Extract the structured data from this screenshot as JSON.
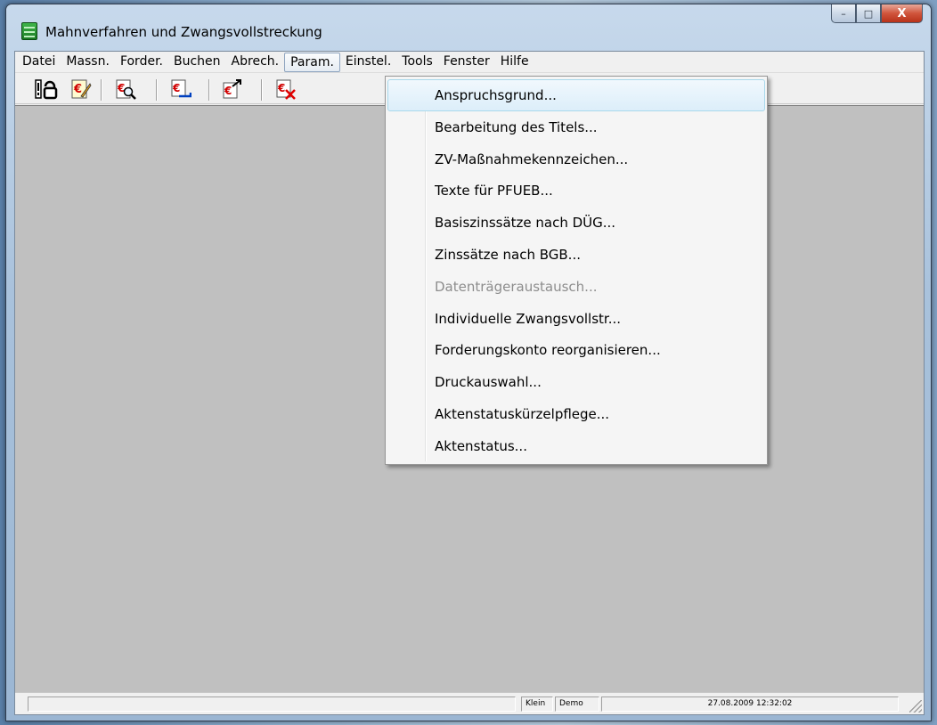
{
  "window": {
    "title": "Mahnverfahren und Zwangsvollstreckung",
    "controls": {
      "minimize": "–",
      "maximize": "□",
      "close": "X"
    }
  },
  "menu_bar": {
    "items": [
      {
        "label": "Datei"
      },
      {
        "label": "Massn."
      },
      {
        "label": "Forder."
      },
      {
        "label": "Buchen"
      },
      {
        "label": "Abrech."
      },
      {
        "label": "Param.",
        "active": true
      },
      {
        "label": "Einstel."
      },
      {
        "label": "Tools"
      },
      {
        "label": "Fenster"
      },
      {
        "label": "Hilfe"
      }
    ]
  },
  "toolbar": {
    "icons": [
      "info-lock-icon",
      "euro-edit-icon",
      "euro-search-icon",
      "euro-list-icon",
      "euro-export-icon",
      "euro-delete-icon",
      "help-icon"
    ],
    "help_glyph": "?"
  },
  "dropdown": {
    "menu": "Param.",
    "items": [
      {
        "label": "Anspruchsgrund...",
        "highlighted": true,
        "enabled": true
      },
      {
        "label": "Bearbeitung des Titels...",
        "enabled": true
      },
      {
        "label": "ZV-Maßnahmekennzeichen...",
        "enabled": true
      },
      {
        "label": "Texte für PFUEB...",
        "enabled": true
      },
      {
        "label": "Basiszinssätze nach DÜG...",
        "enabled": true
      },
      {
        "label": "Zinssätze nach BGB...",
        "enabled": true
      },
      {
        "label": "Datenträgeraustausch...",
        "enabled": false
      },
      {
        "label": "Individuelle Zwangsvollstr...",
        "enabled": true
      },
      {
        "label": "Forderungskonto reorganisieren...",
        "enabled": true
      },
      {
        "label": "Druckauswahl...",
        "enabled": true
      },
      {
        "label": "Aktenstatuskürzelpflege...",
        "enabled": true
      },
      {
        "label": "Aktenstatus...",
        "enabled": true
      }
    ]
  },
  "status_bar": {
    "user": "Klein",
    "mode": "Demo",
    "datetime": "27.08.2009 12:32:02"
  },
  "colors": {
    "mdi_background": "#c0c0c0",
    "menu_highlight": "#dceefa",
    "disabled_text": "#8d8d8d"
  }
}
